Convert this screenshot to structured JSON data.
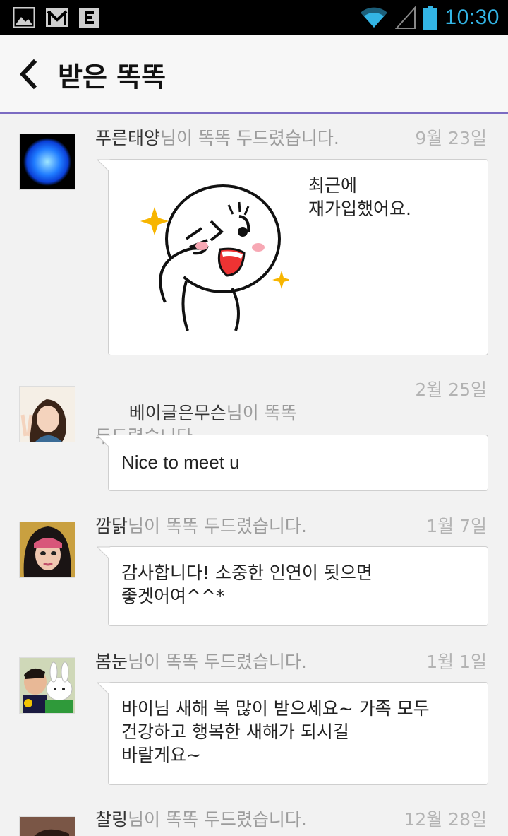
{
  "status_bar": {
    "time": "10:30",
    "time_color": "#33b5e5",
    "left_icons": [
      "gallery-icon",
      "gmail-icon",
      "e-notification-icon"
    ],
    "right_icons": [
      "wifi-icon",
      "cell-signal-icon",
      "battery-icon"
    ]
  },
  "app_bar": {
    "back_icon": "chevron-left-icon",
    "title": "받은 똑똑",
    "accent_color": "#7b6bc2"
  },
  "messages": [
    {
      "sender": "푸른태양",
      "suffix": "님이 똑똑 두드렸습니다.",
      "date": "9월 23일",
      "text": "최근에\n재가입했어요.",
      "has_sticker": true,
      "sticker": "waving-character-sticker",
      "avatar": "blue-sun-avatar"
    },
    {
      "sender": "베이글은무슨",
      "suffix": "님이 똑똑\n두드렸습니다.",
      "date": "2월 25일",
      "text": "Nice to meet u",
      "avatar": "woman-v-sign-avatar"
    },
    {
      "sender": "깜닭",
      "suffix": "님이 똑똑 두드렸습니다.",
      "date": "1월 7일",
      "text": "감사합니다! 소중한 인연이 됫으면\n좋겟어여^^*",
      "avatar": "pink-hair-avatar"
    },
    {
      "sender": "봄눈",
      "suffix": "님이 똑똑 두드렸습니다.",
      "date": "1월 1일",
      "text": "바이님 새해 복 많이 받으세요~ 가족 모두\n건강하고 행복한 새해가 되시길\n바랄게요~",
      "avatar": "boy-with-bunny-avatar"
    },
    {
      "sender": "찰링",
      "suffix": "님이 똑똑 두드렸습니다.",
      "date": "12월 28일",
      "avatar": "partial-avatar"
    }
  ]
}
